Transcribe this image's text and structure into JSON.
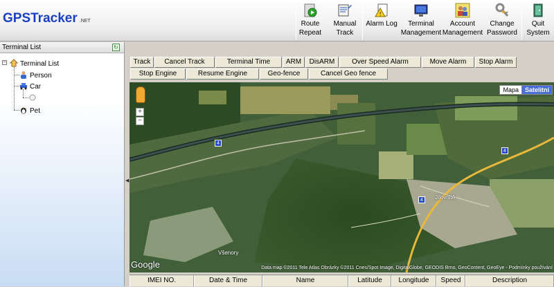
{
  "app": {
    "logo_gps": "GPS",
    "logo_tracker": "Tracker",
    "logo_net": ".NET"
  },
  "toolbar": [
    {
      "id": "route-repeat",
      "line1": "Route",
      "line2": "Repeat",
      "icon": "play-route-icon"
    },
    {
      "id": "manual-track",
      "line1": "Manual",
      "line2": "Track",
      "icon": "manual-track-icon"
    },
    {
      "id": "alarm-log",
      "line1": "Alarm Log",
      "line2": "",
      "icon": "alarm-log-icon"
    },
    {
      "id": "terminal-management",
      "line1": "Terminal",
      "line2": "Management",
      "icon": "terminal-icon"
    },
    {
      "id": "account-management",
      "line1": "Account",
      "line2": "Management",
      "icon": "users-icon"
    },
    {
      "id": "change-password",
      "line1": "Change",
      "line2": "Password",
      "icon": "key-icon"
    },
    {
      "id": "quit-system",
      "line1": "Quit",
      "line2": "System",
      "icon": "quit-icon"
    }
  ],
  "left_panel": {
    "title": "Terminal List",
    "tree": {
      "root": "Terminal List",
      "children": [
        "Person",
        "Car",
        "Pet"
      ]
    }
  },
  "commands": {
    "row1": [
      "Track",
      "Cancel Track",
      "Terminal Time",
      "ARM",
      "DisARM",
      "Over Speed Alarm",
      "Move Alarm",
      "Stop Alarm"
    ],
    "row2": [
      "Stop Engine",
      "Resume Engine",
      "Geo-fence",
      "Cancel Geo fence"
    ]
  },
  "map": {
    "type_map": "Mapa",
    "type_satellite": "Satelitní",
    "zoom_in": "+",
    "zoom_out": "−",
    "google": "Google",
    "attribution": "Data map ©2011 Tele Atlas  Obrázky ©2011 Cnes/Spot Image, DigitalGlobe, GEODIS Brno, GeoContent, GeoEye - Podmínky používání",
    "places": [
      "Jílovíště",
      "Všenory"
    ],
    "road_shields": [
      "4",
      "4",
      "4"
    ]
  },
  "grid": {
    "columns": [
      "IMEI NO.",
      "Date & Time",
      "Name",
      "Latitude",
      "Longitude",
      "Speed",
      "Description"
    ]
  },
  "colors": {
    "satellite_button": "#4a6fd8",
    "highway": "#e8b83a"
  }
}
